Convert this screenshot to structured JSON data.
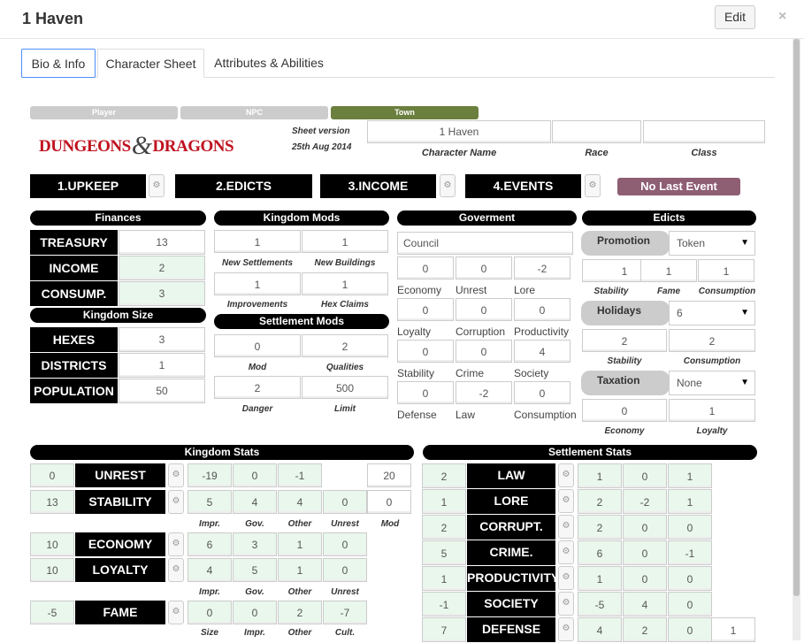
{
  "header": {
    "title": "1 Haven",
    "edit": "Edit",
    "close": "×"
  },
  "tabs": [
    "Bio & Info",
    "Character Sheet",
    "Attributes & Abilities"
  ],
  "sheet_type": {
    "player": "Player",
    "npc": "NPC",
    "town": "Town",
    "accent": "#6b7f3e"
  },
  "logo": {
    "left": "DUNGEONS",
    "amp": "&",
    "right": "DRAGONS"
  },
  "sheet_version": {
    "label": "Sheet version",
    "date": "25th Aug 2014"
  },
  "character": {
    "name": "1 Haven",
    "race": "",
    "class": "",
    "name_label": "Character Name",
    "race_label": "Race",
    "class_label": "Class"
  },
  "phases": [
    "1.UPKEEP",
    "2.EDICTS",
    "3.INCOME",
    "4.EVENTS"
  ],
  "last_event": "No Last Event",
  "finances": {
    "title": "Finances",
    "rows": [
      {
        "label": "TREASURY",
        "value": "13"
      },
      {
        "label": "INCOME",
        "value": "2"
      },
      {
        "label": "CONSUMP.",
        "value": "3"
      }
    ]
  },
  "kingdom_size": {
    "title": "Kingdom Size",
    "rows": [
      {
        "label": "HEXES",
        "value": "3"
      },
      {
        "label": "DISTRICTS",
        "value": "1"
      },
      {
        "label": "POPULATION",
        "value": "50"
      }
    ]
  },
  "kingdom_mods": {
    "title": "Kingdom Mods",
    "new_settlements": "1",
    "new_buildings": "1",
    "improvements": "1",
    "hex_claims": "1",
    "l1": "New Settlements",
    "l2": "New Buildings",
    "l3": "Improvements",
    "l4": "Hex Claims"
  },
  "settlement_mods": {
    "title": "Settlement Mods",
    "mod": "0",
    "qualities": "2",
    "danger": "2",
    "limit": "500",
    "l1": "Mod",
    "l2": "Qualities",
    "l3": "Danger",
    "l4": "Limit"
  },
  "government": {
    "title": "Goverment",
    "type": "Council",
    "rows": [
      {
        "values": [
          "0",
          "0",
          "-2"
        ],
        "labels": [
          "Economy",
          "Unrest",
          "Lore"
        ]
      },
      {
        "values": [
          "0",
          "0",
          "0"
        ],
        "labels": [
          "Loyalty",
          "Corruption",
          "Productivity"
        ]
      },
      {
        "values": [
          "0",
          "0",
          "4"
        ],
        "labels": [
          "Stability",
          "Crime",
          "Society"
        ]
      },
      {
        "values": [
          "0",
          "-2",
          "0"
        ],
        "labels": [
          "Defense",
          "Law",
          "Consumption"
        ]
      }
    ]
  },
  "edicts": {
    "title": "Edicts",
    "promotion": {
      "label": "Promotion",
      "value": "Token",
      "vals": [
        "1",
        "1",
        "1"
      ],
      "labels": [
        "Stability",
        "Fame",
        "Consumption"
      ]
    },
    "holidays": {
      "label": "Holidays",
      "value": "6",
      "vals": [
        "2",
        "2"
      ],
      "labels": [
        "Stability",
        "Consumption"
      ]
    },
    "taxation": {
      "label": "Taxation",
      "value": "None",
      "vals": [
        "0",
        "1"
      ],
      "labels": [
        "Economy",
        "Loyalty"
      ]
    }
  },
  "kingdom_stats": {
    "title": "Kingdom Stats",
    "unrest": {
      "label": "UNREST",
      "total": "0",
      "mods": [
        "-19",
        "0",
        "-1"
      ],
      "extra": "20"
    },
    "stability": {
      "label": "STABILITY",
      "total": "13",
      "mods": [
        "5",
        "4",
        "4",
        "0"
      ],
      "extra": "0"
    },
    "labels1": [
      "Impr.",
      "Gov.",
      "Other",
      "Unrest",
      "Mod"
    ],
    "economy": {
      "label": "ECONOMY",
      "total": "10",
      "mods": [
        "6",
        "3",
        "1",
        "0"
      ]
    },
    "loyalty": {
      "label": "LOYALTY",
      "total": "10",
      "mods": [
        "4",
        "5",
        "1",
        "0"
      ]
    },
    "labels2": [
      "Impr.",
      "Gov.",
      "Other",
      "Unrest"
    ],
    "fame": {
      "label": "FAME",
      "total": "-5",
      "mods": [
        "0",
        "0",
        "2",
        "-7"
      ]
    },
    "labels3": [
      "Size",
      "Impr.",
      "Other",
      "Cult."
    ]
  },
  "settlement_stats": {
    "title": "Settlement Stats",
    "rows": [
      {
        "label": "LAW",
        "total": "2",
        "mods": [
          "1",
          "0",
          "1"
        ]
      },
      {
        "label": "LORE",
        "total": "1",
        "mods": [
          "2",
          "-2",
          "1"
        ]
      },
      {
        "label": "CORRUPT.",
        "total": "2",
        "mods": [
          "2",
          "0",
          "0"
        ]
      },
      {
        "label": "CRIME.",
        "total": "5",
        "mods": [
          "6",
          "0",
          "-1"
        ]
      },
      {
        "label": "PRODUCTIVITY",
        "total": "1",
        "mods": [
          "1",
          "0",
          "0"
        ]
      },
      {
        "label": "SOCIETY",
        "total": "-1",
        "mods": [
          "-5",
          "4",
          "0"
        ]
      },
      {
        "label": "DEFENSE",
        "total": "7",
        "mods": [
          "4",
          "2",
          "0"
        ],
        "extra": "1"
      }
    ]
  }
}
